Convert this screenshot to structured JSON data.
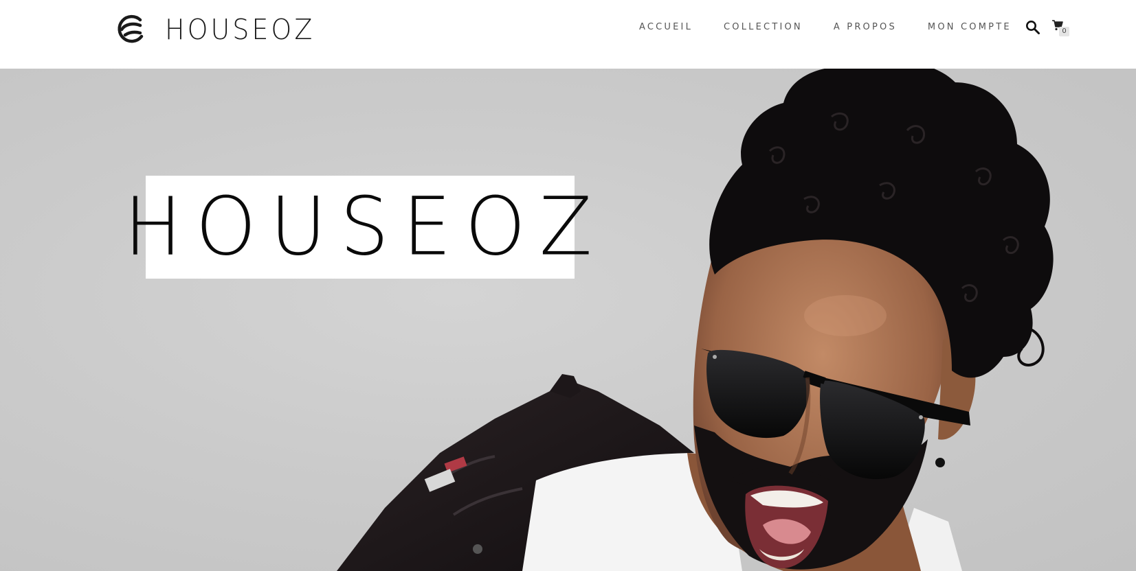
{
  "header": {
    "logo": {
      "mark_icon": "houseoz-logo-mark-icon",
      "wordmark": "HOUSEOZ"
    },
    "nav": [
      {
        "label": "ACCUEIL"
      },
      {
        "label": "COLLECTION"
      },
      {
        "label": "A PROPOS"
      },
      {
        "label": "MON COMPTE"
      }
    ],
    "search": {
      "icon": "search-icon"
    },
    "cart": {
      "icon": "cart-icon",
      "count": "0"
    }
  },
  "hero": {
    "logo_text": "HOUSEOZ",
    "image": "man-with-sunglasses-and-curly-hair-shouting-photo",
    "background_color": "#cbcbcb"
  },
  "colors": {
    "header_bg": "#ffffff",
    "text_dark": "#1a1a1a",
    "nav_text": "#555555"
  }
}
